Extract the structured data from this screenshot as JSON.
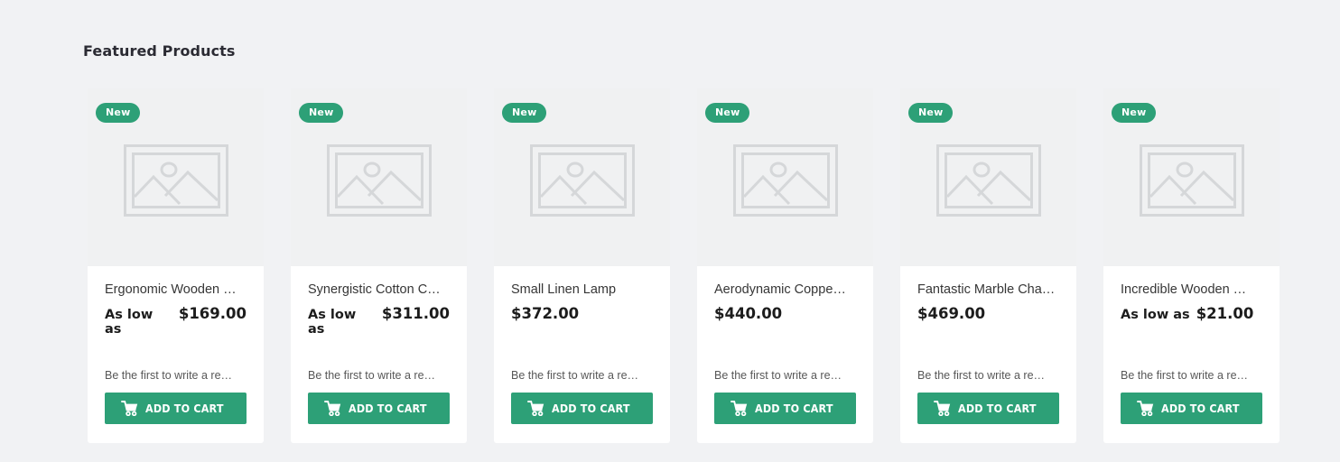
{
  "section": {
    "title": "Featured Products"
  },
  "colors": {
    "accent_green": "#2da077",
    "page_background": "#f1f2f4",
    "card_media_background": "#f0f1f2",
    "card_body_background": "#ffffff",
    "placeholder_icon": "#d2d4d6"
  },
  "labels": {
    "badge_new": "New",
    "price_prefix_as_low_as": "As low as",
    "review_prompt": "Be the first to write a re…",
    "add_to_cart": "ADD TO CART",
    "cart_icon_name": "shopping-cart-icon",
    "placeholder_icon_name": "image-placeholder-icon"
  },
  "products": [
    {
      "name": "Ergonomic Wooden …",
      "badge": "New",
      "price_prefix": "As low as",
      "price": "$169.00",
      "review_prompt": "Be the first to write a re…",
      "add_to_cart": "ADD TO CART"
    },
    {
      "name": "Synergistic Cotton C…",
      "badge": "New",
      "price_prefix": "As low as",
      "price": "$311.00",
      "review_prompt": "Be the first to write a re…",
      "add_to_cart": "ADD TO CART"
    },
    {
      "name": "Small Linen Lamp",
      "badge": "New",
      "price_prefix": "",
      "price": "$372.00",
      "review_prompt": "Be the first to write a re…",
      "add_to_cart": "ADD TO CART"
    },
    {
      "name": "Aerodynamic Coppe…",
      "badge": "New",
      "price_prefix": "",
      "price": "$440.00",
      "review_prompt": "Be the first to write a re…",
      "add_to_cart": "ADD TO CART"
    },
    {
      "name": "Fantastic Marble Cha…",
      "badge": "New",
      "price_prefix": "",
      "price": "$469.00",
      "review_prompt": "Be the first to write a re…",
      "add_to_cart": "ADD TO CART"
    },
    {
      "name": "Incredible Wooden …",
      "badge": "New",
      "price_prefix": "As low as",
      "price": "$21.00",
      "review_prompt": "Be the first to write a re…",
      "add_to_cart": "ADD TO CART"
    }
  ]
}
